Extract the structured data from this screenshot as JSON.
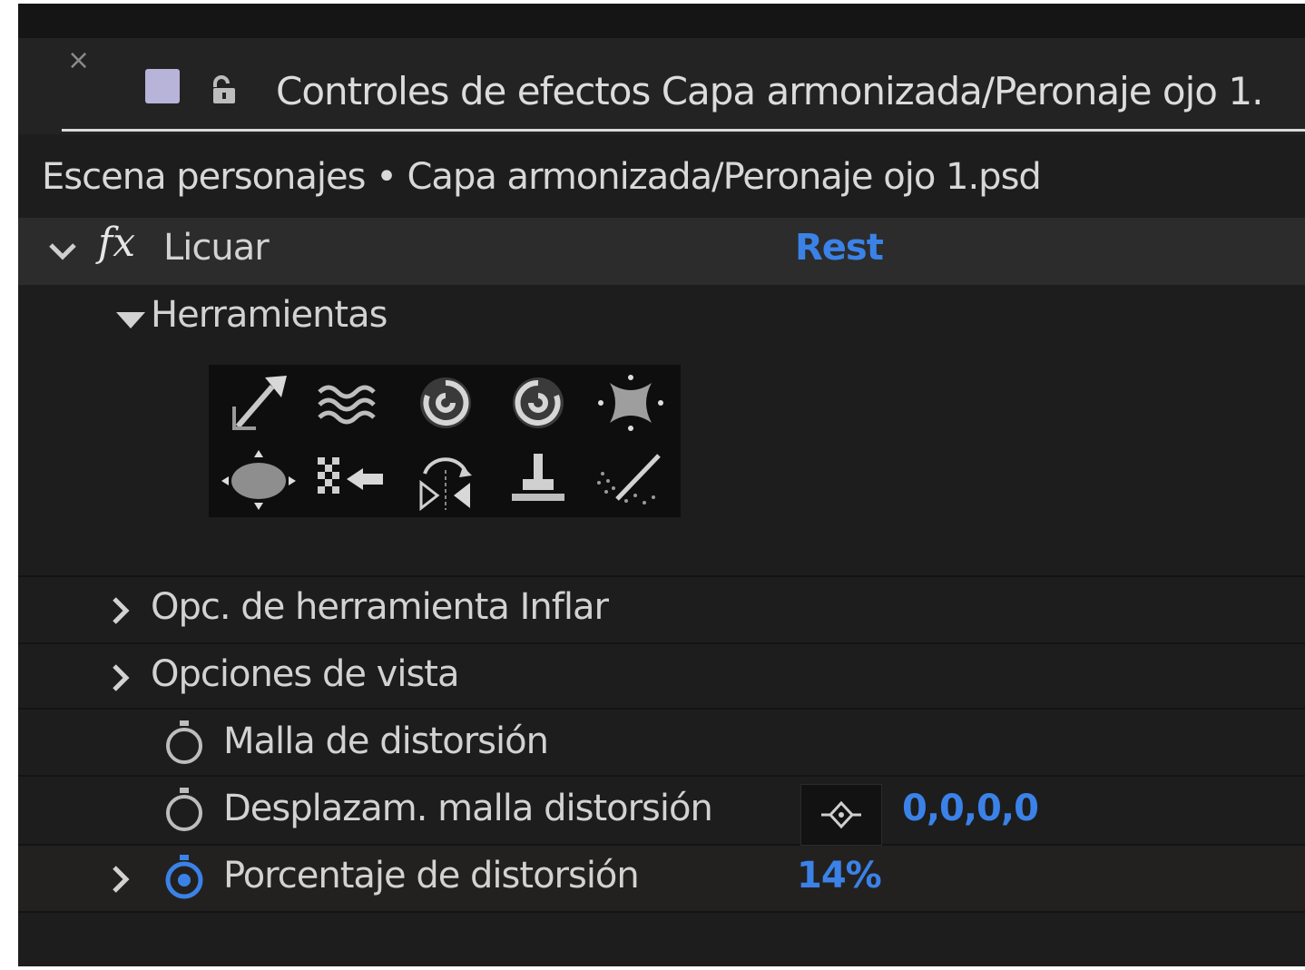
{
  "tab": {
    "close_glyph": "×",
    "title": "Controles de efectos Capa armonizada/Peronaje ojo 1."
  },
  "subheader": "Escena personajes • Capa armonizada/Peronaje ojo 1.psd",
  "effect": {
    "fx_glyph": "fx",
    "name": "Licuar",
    "reset": "Rest"
  },
  "sections": {
    "herramientas": "Herramientas",
    "opc_inflar": "Opc. de herramienta Inflar",
    "opciones_vista": "Opciones de vista"
  },
  "properties": {
    "malla": "Malla de distorsión",
    "desplazam": "Desplazam. malla distorsión",
    "desplazam_value": "0,0,0,0",
    "porcentaje": "Porcentaje de distorsión",
    "porcentaje_value": "14%"
  },
  "tools": [
    "warp-tool-icon",
    "turbulence-tool-icon",
    "twirl-cw-tool-icon",
    "twirl-ccw-tool-icon",
    "pucker-tool-icon",
    "bloat-tool-icon",
    "shift-pixels-tool-icon",
    "reflection-tool-icon",
    "clone-stamp-tool-icon",
    "reconstruction-tool-icon"
  ],
  "colors": {
    "accent": "#3b82e8",
    "panel": "#1d1d1d",
    "swatch": "#b7b3d9"
  }
}
